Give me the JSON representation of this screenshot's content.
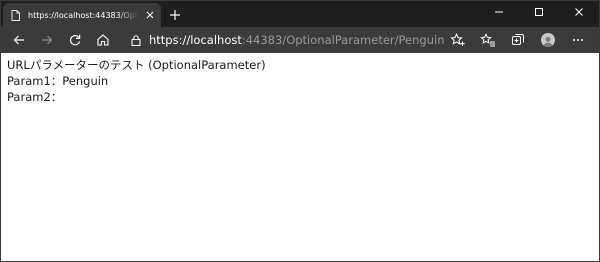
{
  "tab": {
    "title": "https://localhost:44383/OptionalParameter/Penguin"
  },
  "address_bar": {
    "scheme": "https://",
    "host": "localhost",
    "rest": ":44383/OptionalParameter/Penguin"
  },
  "icons": {
    "page": "page-icon",
    "tab_close": "close-icon",
    "new_tab": "plus-icon",
    "minimize": "minimize-icon",
    "maximize": "maximize-icon",
    "close": "close-icon",
    "back": "arrow-left-icon",
    "forward": "arrow-right-icon",
    "refresh": "refresh-icon",
    "home": "home-icon",
    "lock": "lock-icon",
    "favorite_add": "star-plus-icon",
    "favorites": "favorites-list-icon",
    "collections": "collections-icon",
    "profile": "avatar",
    "menu": "more-icon"
  },
  "colors": {
    "titlebar_bg": "#1f1f1f",
    "toolbar_bg": "#3b3b3b",
    "page_bg": "#ffffff",
    "url_dim": "#9a9a9a"
  },
  "page": {
    "heading": "URLパラメーターのテスト (OptionalParameter)",
    "param1": "Param1：Penguin",
    "param2": "Param2："
  }
}
